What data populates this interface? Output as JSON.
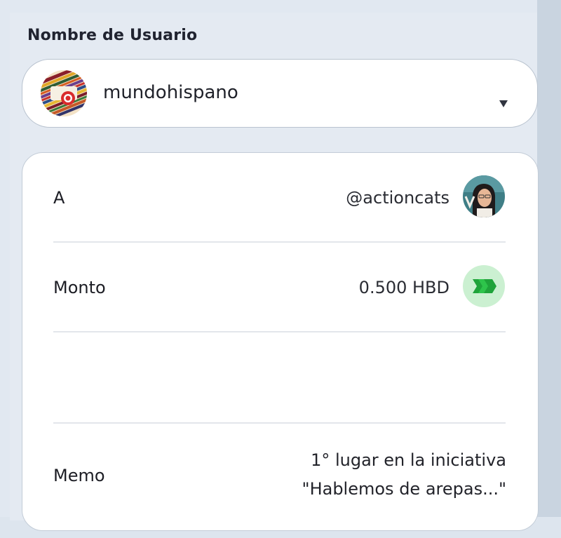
{
  "form": {
    "username_label": "Nombre de Usuario"
  },
  "account": {
    "name": "mundohispano",
    "avatar_icon": "mundohispano-logo-icon",
    "dropdown_icon": "caret-down-icon"
  },
  "transfer": {
    "to_label": "A",
    "to_value": "@actioncats",
    "to_avatar_icon": "user-avatar-icon",
    "amount_label": "Monto",
    "amount_value": "0.500 HBD",
    "amount_icon": "hbd-token-icon",
    "memo_label": "Memo",
    "memo_line1": "1° lugar en la iniciativa",
    "memo_line2": "\"Hablemos de arepas...\""
  },
  "colors": {
    "page_background": "#e1e8f1",
    "card_background": "#ffffff",
    "hbd_green": "#2ec44b",
    "hbd_bg": "#cbf0d1"
  }
}
